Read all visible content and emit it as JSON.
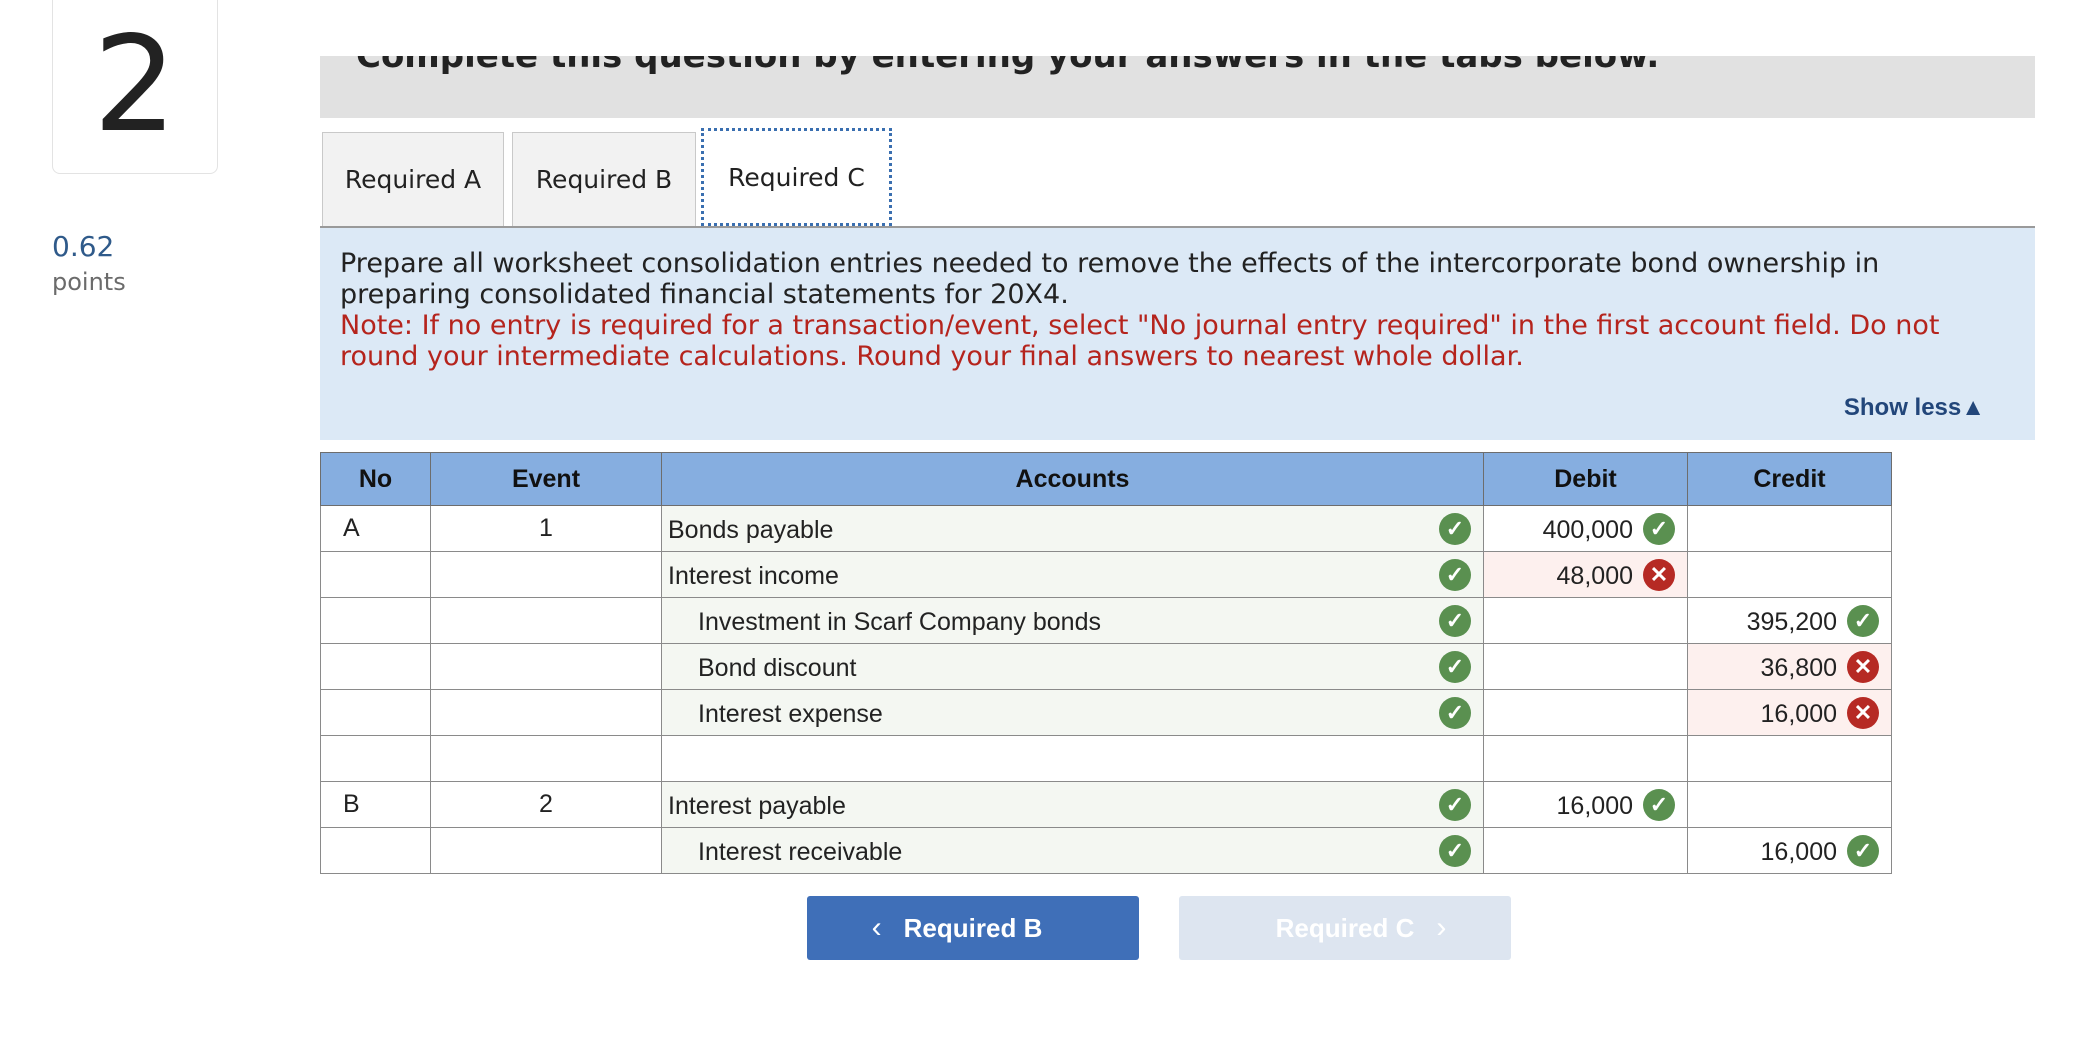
{
  "question": {
    "number": "2",
    "points_value": "0.62",
    "points_label": "points"
  },
  "instructions": "Complete this question by entering your answers in the tabs below.",
  "tabs": [
    {
      "label": "Required A"
    },
    {
      "label": "Required B"
    },
    {
      "label": "Required C",
      "active": true
    }
  ],
  "info": {
    "main": "Prepare all worksheet consolidation entries needed to remove the effects of the intercorporate bond ownership in preparing consolidated financial statements for 20X4.",
    "note": "Note: If no entry is required for a transaction/event, select \"No journal entry required\" in the first account field. Do not round your intermediate calculations. Round your final answers to nearest whole dollar.",
    "toggle": "Show less",
    "toggle_icon": "▲"
  },
  "table": {
    "headers": {
      "no": "No",
      "event": "Event",
      "accounts": "Accounts",
      "debit": "Debit",
      "credit": "Credit"
    },
    "rows": [
      {
        "no": "A",
        "event": "1",
        "account": "Bonds payable",
        "indent": false,
        "account_ok": true,
        "debit": "400,000",
        "debit_ok": true,
        "credit": "",
        "credit_ok": null
      },
      {
        "no": "",
        "event": "",
        "account": "Interest income",
        "indent": false,
        "account_ok": true,
        "debit": "48,000",
        "debit_ok": false,
        "credit": "",
        "credit_ok": null
      },
      {
        "no": "",
        "event": "",
        "account": "Investment in Scarf Company bonds",
        "indent": true,
        "account_ok": true,
        "debit": "",
        "debit_ok": null,
        "credit": "395,200",
        "credit_ok": true
      },
      {
        "no": "",
        "event": "",
        "account": "Bond discount",
        "indent": true,
        "account_ok": true,
        "debit": "",
        "debit_ok": null,
        "credit": "36,800",
        "credit_ok": false
      },
      {
        "no": "",
        "event": "",
        "account": "Interest expense",
        "indent": true,
        "account_ok": true,
        "debit": "",
        "debit_ok": null,
        "credit": "16,000",
        "credit_ok": false
      },
      {
        "no": "",
        "event": "",
        "account": "",
        "indent": false,
        "account_ok": null,
        "debit": "",
        "debit_ok": null,
        "credit": "",
        "credit_ok": null
      },
      {
        "no": "B",
        "event": "2",
        "account": "Interest payable",
        "indent": false,
        "account_ok": true,
        "debit": "16,000",
        "debit_ok": true,
        "credit": "",
        "credit_ok": null
      },
      {
        "no": "",
        "event": "",
        "account": "Interest receivable",
        "indent": true,
        "account_ok": true,
        "debit": "",
        "debit_ok": null,
        "credit": "16,000",
        "credit_ok": true
      }
    ]
  },
  "nav": {
    "prev_label": "Required B",
    "prev_icon": "‹",
    "next_label": "Required C",
    "next_icon": "›"
  },
  "colors": {
    "correct": "#5a9050",
    "incorrect": "#b62a24",
    "header": "#86aee0",
    "primary_button": "#3f6fb8"
  }
}
